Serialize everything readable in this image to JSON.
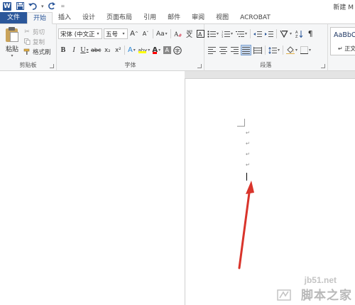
{
  "titlebar": {
    "app_icon_letter": "W",
    "title": "新建 M",
    "qat": [
      "save-icon",
      "undo-icon",
      "redo-icon",
      "customize-icon"
    ]
  },
  "tabs": [
    "文件",
    "开始",
    "插入",
    "设计",
    "页面布局",
    "引用",
    "邮件",
    "审阅",
    "视图",
    "ACROBAT"
  ],
  "active_tab": "开始",
  "clipboard": {
    "paste": "粘贴",
    "cut": "剪切",
    "copy": "复制",
    "format_painter": "格式刷",
    "group_label": "剪贴板"
  },
  "font": {
    "font_name": "宋体 (中文正文",
    "font_size": "五号",
    "grow": "A",
    "shrink": "A",
    "change_case": "Aa",
    "bold": "B",
    "italic": "I",
    "underline": "U",
    "strike": "abc",
    "subscript": "x₂",
    "superscript": "x²",
    "effects": "A",
    "highlight": "aby",
    "font_color": "A",
    "shading": "A",
    "group_label": "字体"
  },
  "paragraph": {
    "pilcrow": "¶",
    "group_label": "段落"
  },
  "styles": {
    "sample": "AaBbCcDd",
    "name": "↵ 正文"
  },
  "document": {
    "paragraph_marks": [
      "↵",
      "↵",
      "↵",
      "↵"
    ]
  },
  "watermark": {
    "site": "jb51.net",
    "name": "脚本之家"
  },
  "colors": {
    "brand": "#2b579a",
    "arrow": "#d9342b",
    "highlight": "#ffff00",
    "font_color": "#ff0000"
  }
}
